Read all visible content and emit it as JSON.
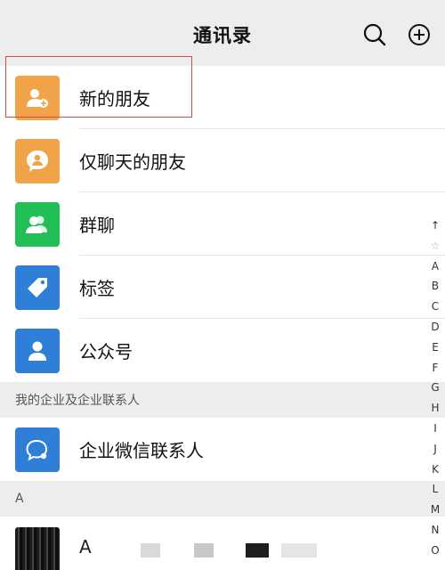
{
  "header": {
    "title": "通讯录"
  },
  "items": [
    {
      "label": "新的朋友",
      "color": "#f0a347",
      "icon": "add-friend-icon"
    },
    {
      "label": "仅聊天的朋友",
      "color": "#f0a347",
      "icon": "chat-only-friend-icon"
    },
    {
      "label": "群聊",
      "color": "#21bf56",
      "icon": "group-chat-icon"
    },
    {
      "label": "标签",
      "color": "#2f7ed8",
      "icon": "tag-icon"
    },
    {
      "label": "公众号",
      "color": "#2f7ed8",
      "icon": "official-account-icon"
    }
  ],
  "enterprise_section": {
    "title": "我的企业及企业联系人",
    "item": {
      "label": "企业微信联系人",
      "color": "#2f7ed8",
      "icon": "work-contact-icon"
    }
  },
  "contacts_section": {
    "letter": "A",
    "first_contact": {
      "name": "A"
    }
  },
  "index_letters": [
    "↑",
    "☆",
    "A",
    "B",
    "C",
    "D",
    "E",
    "F",
    "G",
    "H",
    "I",
    "J",
    "K",
    "L",
    "M",
    "N",
    "O"
  ]
}
